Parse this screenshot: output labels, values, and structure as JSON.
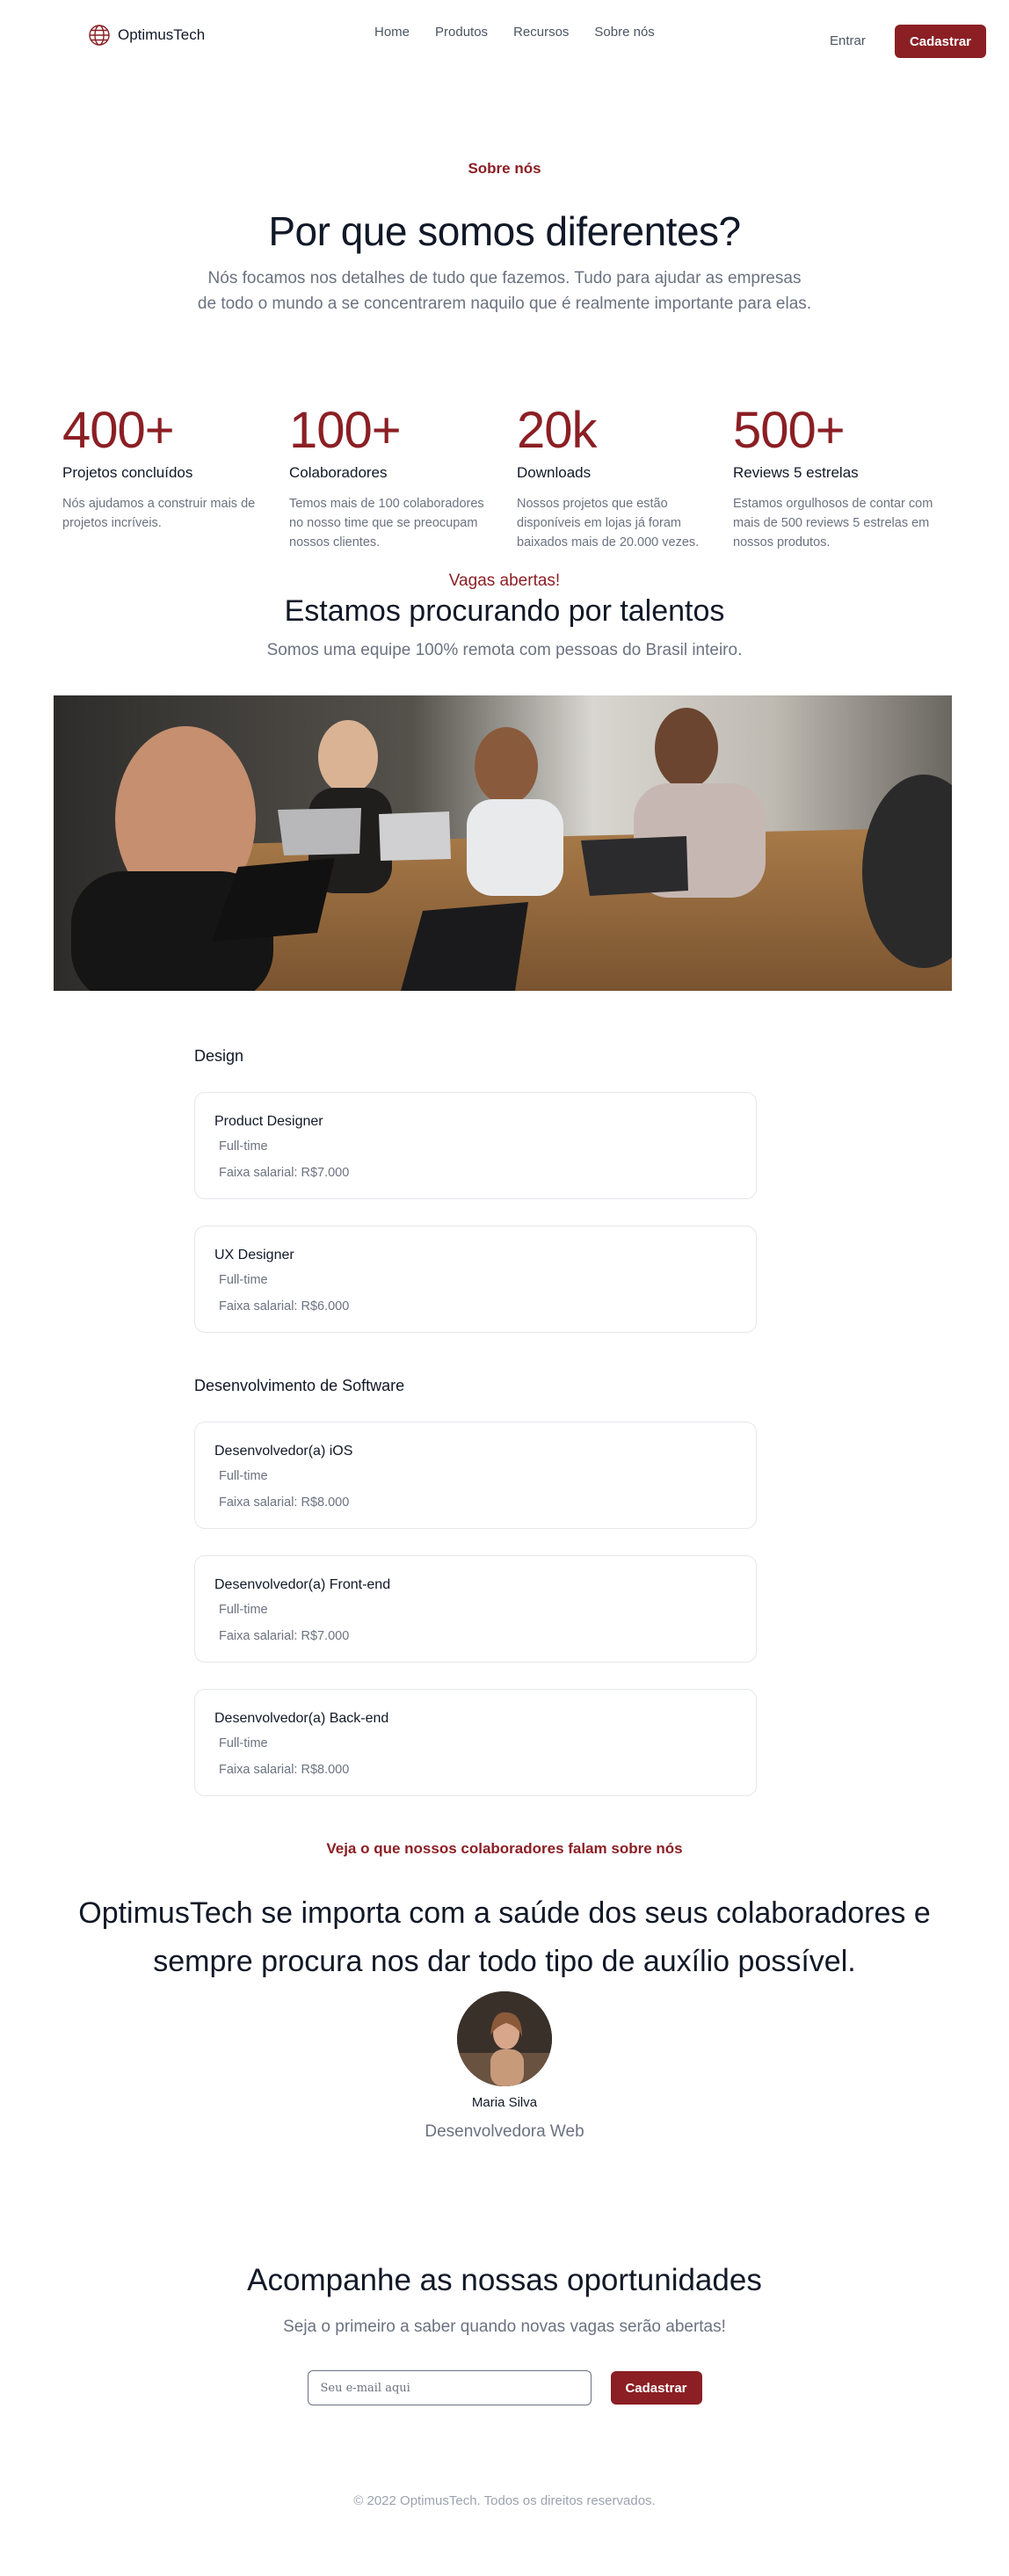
{
  "nav": {
    "brand": "OptimusTech",
    "links": [
      "Home",
      "Produtos",
      "Recursos",
      "Sobre nós"
    ],
    "login": "Entrar",
    "signup": "Cadastrar"
  },
  "hero": {
    "eyebrow": "Sobre nós",
    "title": "Por que somos diferentes?",
    "subtitle": "Nós focamos nos detalhes de tudo que fazemos. Tudo para ajudar as empresas de todo o mundo a se concentrarem naquilo que é realmente importante para elas."
  },
  "stats": [
    {
      "value": "400+",
      "label": "Projetos concluídos",
      "desc": "Nós ajudamos a construir mais de projetos incríveis."
    },
    {
      "value": "100+",
      "label": "Colaboradores",
      "desc": "Temos mais de 100 colaboradores no nosso time que se preocupam nossos clientes."
    },
    {
      "value": "20k",
      "label": "Downloads",
      "desc": "Nossos projetos que estão disponíveis em lojas já foram baixados mais de 20.000 vezes."
    },
    {
      "value": "500+",
      "label": "Reviews 5 estrelas",
      "desc": "Estamos orgulhosos de contar com mais de 500 reviews 5 estrelas em nossos produtos."
    }
  ],
  "jobs_intro": {
    "eyebrow": "Vagas abertas!",
    "title": "Estamos procurando por talentos",
    "subtitle": "Somos uma equipe 100% remota com pessoas do Brasil inteiro."
  },
  "departments": [
    {
      "name": "Design",
      "jobs": [
        {
          "title": "Product Designer",
          "type": "Full-time",
          "salary": "Faixa salarial: R$7.000"
        },
        {
          "title": "UX Designer",
          "type": "Full-time",
          "salary": "Faixa salarial: R$6.000"
        }
      ]
    },
    {
      "name": "Desenvolvimento de Software",
      "jobs": [
        {
          "title": "Desenvolvedor(a) iOS",
          "type": "Full-time",
          "salary": "Faixa salarial: R$8.000"
        },
        {
          "title": "Desenvolvedor(a) Front-end",
          "type": "Full-time",
          "salary": "Faixa salarial: R$7.000"
        },
        {
          "title": "Desenvolvedor(a) Back-end",
          "type": "Full-time",
          "salary": "Faixa salarial: R$8.000"
        }
      ]
    }
  ],
  "testimonial": {
    "eyebrow": "Veja o que nossos colaboradores falam sobre nós",
    "quote": "OptimusTech se importa com a saúde dos seus colaboradores e sempre procura nos dar todo tipo de auxílio possível.",
    "name": "Maria Silva",
    "role": "Desenvolvedora Web"
  },
  "newsletter": {
    "title": "Acompanhe as nossas oportunidades",
    "subtitle": "Seja o primeiro a saber quando novas vagas serão abertas!",
    "placeholder": "Seu e-mail aqui",
    "button": "Cadastrar"
  },
  "footer": {
    "text": "© 2022 OptimusTech. Todos os direitos reservados."
  },
  "colors": {
    "accent": "#8b1f24",
    "text": "#111827",
    "muted": "#6b7280"
  }
}
